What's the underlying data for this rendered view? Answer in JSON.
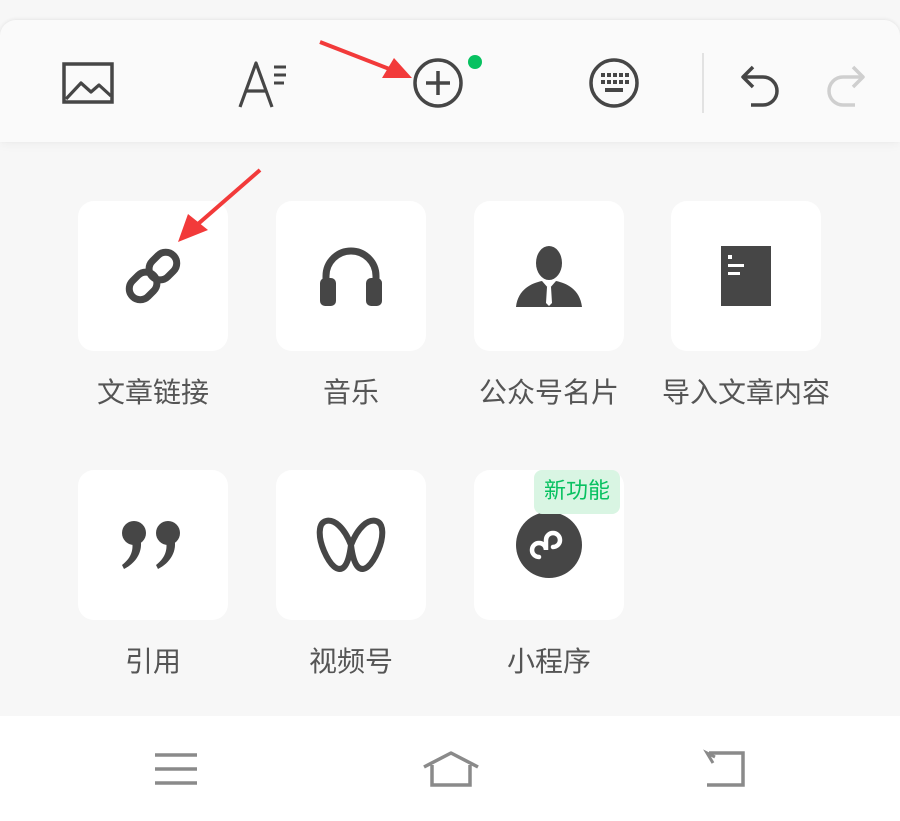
{
  "colors": {
    "accent_green": "#07c160",
    "badge_bg": "#d9f5e3",
    "icon_dark": "#464646",
    "annotation_red": "#f23a3a"
  },
  "toolbar": {
    "buttons": [
      {
        "name": "image-button",
        "icon": "image-icon"
      },
      {
        "name": "text-format-button",
        "icon": "text-format-icon"
      },
      {
        "name": "insert-more-button",
        "icon": "plus-circle-icon",
        "has_new_dot": true
      },
      {
        "name": "keyboard-button",
        "icon": "keyboard-icon"
      },
      {
        "name": "undo-button",
        "icon": "undo-icon"
      },
      {
        "name": "redo-button",
        "icon": "redo-icon",
        "disabled": true
      }
    ]
  },
  "grid": {
    "items": [
      {
        "label": "文章链接",
        "icon": "link-icon"
      },
      {
        "label": "音乐",
        "icon": "headphones-icon"
      },
      {
        "label": "公众号名片",
        "icon": "person-icon"
      },
      {
        "label": "导入文章内容",
        "icon": "document-icon"
      },
      {
        "label": "引用",
        "icon": "quote-icon"
      },
      {
        "label": "视频号",
        "icon": "channels-icon"
      },
      {
        "label": "小程序",
        "icon": "mini-program-icon",
        "badge": "新功能"
      }
    ]
  },
  "nav": {
    "buttons": [
      {
        "name": "menu-button",
        "icon": "menu-icon"
      },
      {
        "name": "home-button",
        "icon": "home-icon"
      },
      {
        "name": "back-button",
        "icon": "back-icon"
      }
    ]
  }
}
